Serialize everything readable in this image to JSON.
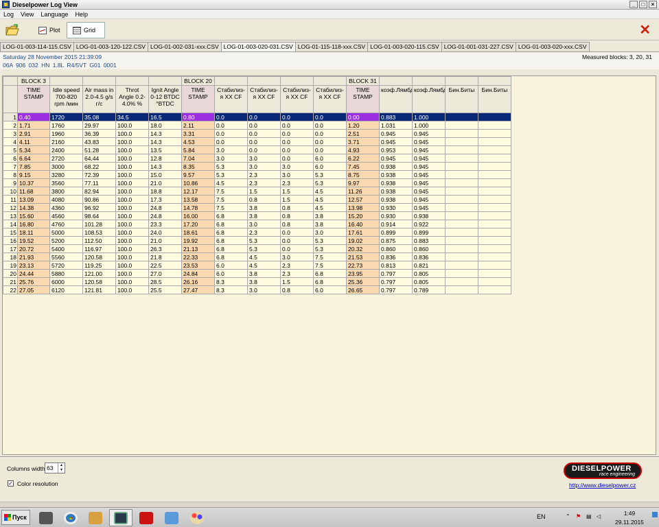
{
  "window": {
    "title": "Dieselpower Log View"
  },
  "menu": [
    "Log",
    "View",
    "Language",
    "Help"
  ],
  "toolbar": {
    "plot_label": "Plot",
    "grid_label": "Grid"
  },
  "tabs": [
    {
      "label": "LOG-01-003-114-115.CSV",
      "active": false
    },
    {
      "label": "LOG-01-003-120-122.CSV",
      "active": false
    },
    {
      "label": "LOG-01-002-031-xxx.CSV",
      "active": false
    },
    {
      "label": "LOG-01-003-020-031.CSV",
      "active": true
    },
    {
      "label": "LOG-01-115-118-xxx.CSV",
      "active": false
    },
    {
      "label": "LOG-01-003-020-115.CSV",
      "active": false
    },
    {
      "label": "LOG-01-001-031-227.CSV",
      "active": false
    },
    {
      "label": "LOG-01-003-020-xxx.CSV",
      "active": false
    }
  ],
  "info": {
    "date": "Saturday 28 November 2015 21:39:09",
    "ecu": "06A 906 032 HN  1.8L R4/5VT    G01 0001",
    "measured_blocks": "Measured blocks: 3, 20, 31"
  },
  "grid": {
    "block_headers": [
      "BLOCK 3",
      "",
      "",
      "",
      "",
      "BLOCK 20",
      "",
      "",
      "",
      "",
      "BLOCK 31",
      "",
      "",
      "",
      ""
    ],
    "columns": [
      {
        "label": "TIME STAMP",
        "ts": true
      },
      {
        "label": "Idle speed 700-820 rpm /мин",
        "ts": false
      },
      {
        "label": "Air mass in 2.0-4.5 g/s г/с",
        "ts": false
      },
      {
        "label": "Throt Angle 0.2-4.0% %",
        "ts": false
      },
      {
        "label": "Ignit Angle 0-12 BTDC °BTDC",
        "ts": false
      },
      {
        "label": "TIME STAMP",
        "ts": true
      },
      {
        "label": "Стабилиз-я XX CF",
        "ts": false
      },
      {
        "label": "Стабилиз-я XX CF",
        "ts": false
      },
      {
        "label": "Стабилиз-я XX CF",
        "ts": false
      },
      {
        "label": "Стабилиз-я XX CF",
        "ts": false
      },
      {
        "label": "TIME STAMP",
        "ts": true
      },
      {
        "label": "коэф.Лямбда",
        "ts": false
      },
      {
        "label": "коэф.Лямбда",
        "ts": false
      },
      {
        "label": "Бин.Биты",
        "ts": false
      },
      {
        "label": "Бин.Биты",
        "ts": false
      }
    ],
    "selected_row": 1,
    "rows": [
      [
        "0.40",
        "1720",
        "35.08",
        "34.5",
        "16.5",
        "0.80",
        "0.0",
        "0.0",
        "0.0",
        "0.0",
        "0.00",
        "0.883",
        "1.000",
        "",
        ""
      ],
      [
        "1.71",
        "1760",
        "29.97",
        "100.0",
        "18.0",
        "2.11",
        "0.0",
        "0.0",
        "0.0",
        "0.0",
        "1.20",
        "1.031",
        "1.000",
        "",
        ""
      ],
      [
        "2.91",
        "1960",
        "36.39",
        "100.0",
        "14.3",
        "3.31",
        "0.0",
        "0.0",
        "0.0",
        "0.0",
        "2.51",
        "0.945",
        "0.945",
        "",
        ""
      ],
      [
        "4.11",
        "2160",
        "43.83",
        "100.0",
        "14.3",
        "4.53",
        "0.0",
        "0.0",
        "0.0",
        "0.0",
        "3.71",
        "0.945",
        "0.945",
        "",
        ""
      ],
      [
        "5.34",
        "2400",
        "51.28",
        "100.0",
        "13.5",
        "5.84",
        "3.0",
        "0.0",
        "0.0",
        "0.0",
        "4.93",
        "0.953",
        "0.945",
        "",
        ""
      ],
      [
        "6.64",
        "2720",
        "64.44",
        "100.0",
        "12.8",
        "7.04",
        "3.0",
        "3.0",
        "0.0",
        "6.0",
        "6.22",
        "0.945",
        "0.945",
        "",
        ""
      ],
      [
        "7.85",
        "3000",
        "68.22",
        "100.0",
        "14.3",
        "8.35",
        "5.3",
        "3.0",
        "3.0",
        "6.0",
        "7.45",
        "0.938",
        "0.945",
        "",
        ""
      ],
      [
        "9.15",
        "3280",
        "72.39",
        "100.0",
        "15.0",
        "9.57",
        "5.3",
        "2.3",
        "3.0",
        "5.3",
        "8.75",
        "0.938",
        "0.945",
        "",
        ""
      ],
      [
        "10.37",
        "3560",
        "77.11",
        "100.0",
        "21.0",
        "10.86",
        "4.5",
        "2.3",
        "2.3",
        "5.3",
        "9.97",
        "0.938",
        "0.945",
        "",
        ""
      ],
      [
        "11.68",
        "3800",
        "82.94",
        "100.0",
        "18.8",
        "12.17",
        "7.5",
        "1.5",
        "1.5",
        "4.5",
        "11.26",
        "0.938",
        "0.945",
        "",
        ""
      ],
      [
        "13.09",
        "4080",
        "90.86",
        "100.0",
        "17.3",
        "13.58",
        "7.5",
        "0.8",
        "1.5",
        "4.5",
        "12.57",
        "0.938",
        "0.945",
        "",
        ""
      ],
      [
        "14.38",
        "4360",
        "96.92",
        "100.0",
        "24.8",
        "14.78",
        "7.5",
        "3.8",
        "0.8",
        "4.5",
        "13.98",
        "0.930",
        "0.945",
        "",
        ""
      ],
      [
        "15.60",
        "4560",
        "98.64",
        "100.0",
        "24.8",
        "16.00",
        "6.8",
        "3.8",
        "0.8",
        "3.8",
        "15.20",
        "0.930",
        "0.938",
        "",
        ""
      ],
      [
        "16.80",
        "4760",
        "101.28",
        "100.0",
        "23.3",
        "17.20",
        "6.8",
        "3.0",
        "0.8",
        "3.8",
        "16.40",
        "0.914",
        "0.922",
        "",
        ""
      ],
      [
        "18.11",
        "5000",
        "108.53",
        "100.0",
        "24.0",
        "18.61",
        "6.8",
        "2.3",
        "0.0",
        "3.0",
        "17.61",
        "0.899",
        "0.899",
        "",
        ""
      ],
      [
        "19.52",
        "5200",
        "112.50",
        "100.0",
        "21.0",
        "19.92",
        "6.8",
        "5.3",
        "0.0",
        "5.3",
        "19.02",
        "0.875",
        "0.883",
        "",
        ""
      ],
      [
        "20.72",
        "5400",
        "116.97",
        "100.0",
        "26.3",
        "21.13",
        "6.8",
        "5.3",
        "0.0",
        "5.3",
        "20.32",
        "0.860",
        "0.860",
        "",
        ""
      ],
      [
        "21.93",
        "5560",
        "120.58",
        "100.0",
        "21.8",
        "22.33",
        "6.8",
        "4.5",
        "3.0",
        "7.5",
        "21.53",
        "0.836",
        "0.836",
        "",
        ""
      ],
      [
        "23.13",
        "5720",
        "119.25",
        "100.0",
        "22.5",
        "23.53",
        "6.0",
        "4.5",
        "2.3",
        "7.5",
        "22.73",
        "0.813",
        "0.821",
        "",
        ""
      ],
      [
        "24.44",
        "5880",
        "121.00",
        "100.0",
        "27.0",
        "24.84",
        "6.0",
        "3.8",
        "2.3",
        "6.8",
        "23.95",
        "0.797",
        "0.805",
        "",
        ""
      ],
      [
        "25.76",
        "6000",
        "120.58",
        "100.0",
        "28.5",
        "26.16",
        "8.3",
        "3.8",
        "1.5",
        "6.8",
        "25.36",
        "0.797",
        "0.805",
        "",
        ""
      ],
      [
        "27.05",
        "6120",
        "121.81",
        "100.0",
        "25.5",
        "27.47",
        "8.3",
        "3.0",
        "0.8",
        "6.0",
        "26.65",
        "0.797",
        "0.789",
        "",
        ""
      ]
    ]
  },
  "bottom": {
    "columns_width_label": "Columns width:",
    "columns_width_value": "63",
    "color_resolution_label": "Color resolution",
    "color_resolution_checked": true,
    "logo_main": "DIESELPOWER",
    "logo_sub": "race engineering",
    "link": "http://www.dieselpower.cz"
  },
  "taskbar": {
    "start_label": "Пуск",
    "lang": "EN",
    "time": "1:49",
    "date": "29.11.2015"
  }
}
